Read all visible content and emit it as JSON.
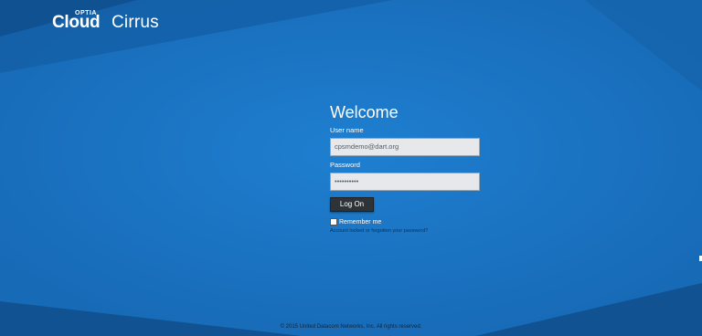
{
  "brand": {
    "prefix": "OPTIA",
    "word_bold": "Cloud",
    "word_light": "Cirrus"
  },
  "login": {
    "title": "Welcome",
    "username_label": "User name",
    "username_value": "cpsmdemo@dart.org",
    "password_label": "Password",
    "password_value": "••••••••••",
    "submit_label": "Log On",
    "remember_label": "Remember me",
    "forgot_link": "Account locked or forgotten your password?"
  },
  "footer": {
    "copyright": "© 2015 United Datacom Networks, Inc. All rights reserved."
  },
  "colors": {
    "background": "#1b72c0",
    "background_dark": "#0f4d8c",
    "button": "#2e3338",
    "link": "#0b2f55"
  }
}
